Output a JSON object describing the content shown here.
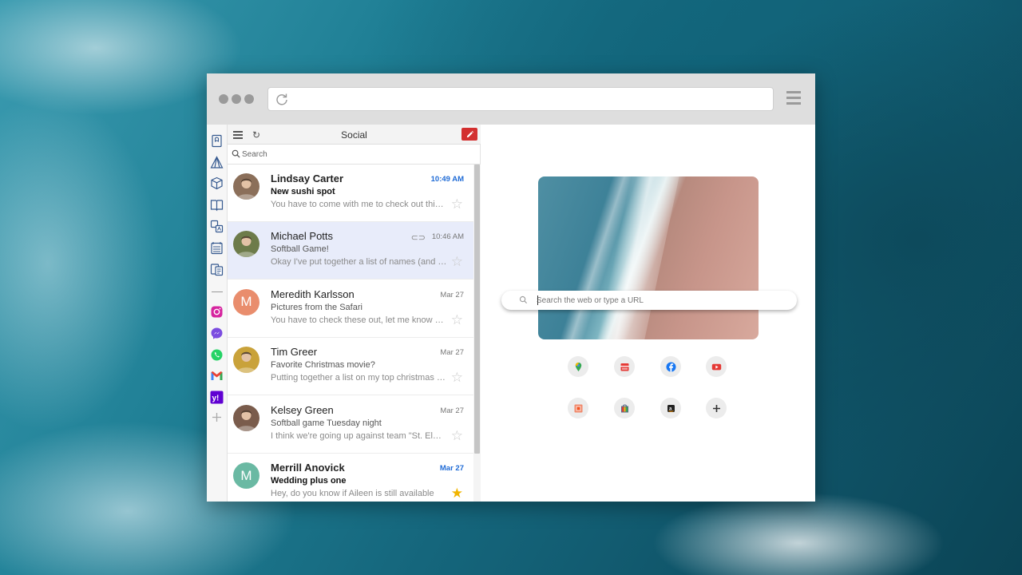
{
  "window": {
    "icon_bar": [
      {
        "icon": "bookmark-icon"
      },
      {
        "icon": "pyramid-icon"
      },
      {
        "icon": "cube-icon"
      },
      {
        "icon": "book-icon"
      },
      {
        "icon": "translate-icon"
      },
      {
        "icon": "calendar-icon"
      },
      {
        "icon": "document-icon"
      },
      {
        "icon": "instagram-icon",
        "color": "#d6249f"
      },
      {
        "icon": "messenger-icon",
        "color": "#7b4ce0"
      },
      {
        "icon": "whatsapp-icon",
        "color": "#25d366"
      },
      {
        "icon": "gmail-icon",
        "color": "#ea4335"
      },
      {
        "icon": "yahoo-icon",
        "color": "#6001d2"
      },
      {
        "icon": "plus-icon"
      }
    ]
  },
  "mail": {
    "title": "Social",
    "refresh_glyph": "↻",
    "search_placeholder": "Search",
    "messages": [
      {
        "sender": "Lindsay Carter",
        "subject": "New sushi spot",
        "preview": "You have to come with me to check out this place",
        "date": "10:49 AM",
        "unread": true,
        "starred": false,
        "attachment": false,
        "avatar": "photo",
        "avatar_color": "#8b6f5a"
      },
      {
        "sender": "Michael Potts",
        "subject": "Softball Game!",
        "preview": "Okay I've put together a list of names (and positions)",
        "date": "10:46 AM",
        "unread": false,
        "starred": false,
        "attachment": true,
        "avatar": "photo",
        "avatar_color": "#6d7b4a",
        "selected": true
      },
      {
        "sender": "Meredith Karlsson",
        "subject": "Pictures from the Safari",
        "preview": "You have to check these out, let me know what you think",
        "date": "Mar 27",
        "unread": false,
        "starred": false,
        "attachment": false,
        "avatar": "M",
        "avatar_color": "#e98d6d"
      },
      {
        "sender": "Tim Greer",
        "subject": "Favorite Christmas movie?",
        "preview": "Putting together a list on my top christmas movies",
        "date": "Mar 27",
        "unread": false,
        "starred": false,
        "attachment": false,
        "avatar": "photo",
        "avatar_color": "#c9a23a"
      },
      {
        "sender": "Kelsey Green",
        "subject": "Softball game Tuesday night",
        "preview": "I think we're going up against team \"St. Elmo's\"",
        "date": "Mar 27",
        "unread": false,
        "starred": false,
        "attachment": false,
        "avatar": "photo",
        "avatar_color": "#7a5c4c"
      },
      {
        "sender": "Merrill Anovick",
        "subject": "Wedding plus one",
        "preview": "Hey, do you know if Aileen is still available",
        "date": "Mar 27",
        "unread": true,
        "starred": true,
        "attachment": false,
        "avatar": "M",
        "avatar_color": "#6ab9a3"
      }
    ],
    "star_glyph": "☆",
    "star_filled_glyph": "★",
    "clip_glyph": "⊂⊃"
  },
  "newtab": {
    "search_placeholder": "Search the web or type a URL",
    "tiles": [
      {
        "icon": "maps-icon"
      },
      {
        "icon": "calendar-app-icon"
      },
      {
        "icon": "facebook-icon"
      },
      {
        "icon": "youtube-icon"
      },
      {
        "icon": "office-icon"
      },
      {
        "icon": "bag-icon"
      },
      {
        "icon": "amazon-icon"
      },
      {
        "icon": "add-shortcut-icon"
      }
    ]
  }
}
